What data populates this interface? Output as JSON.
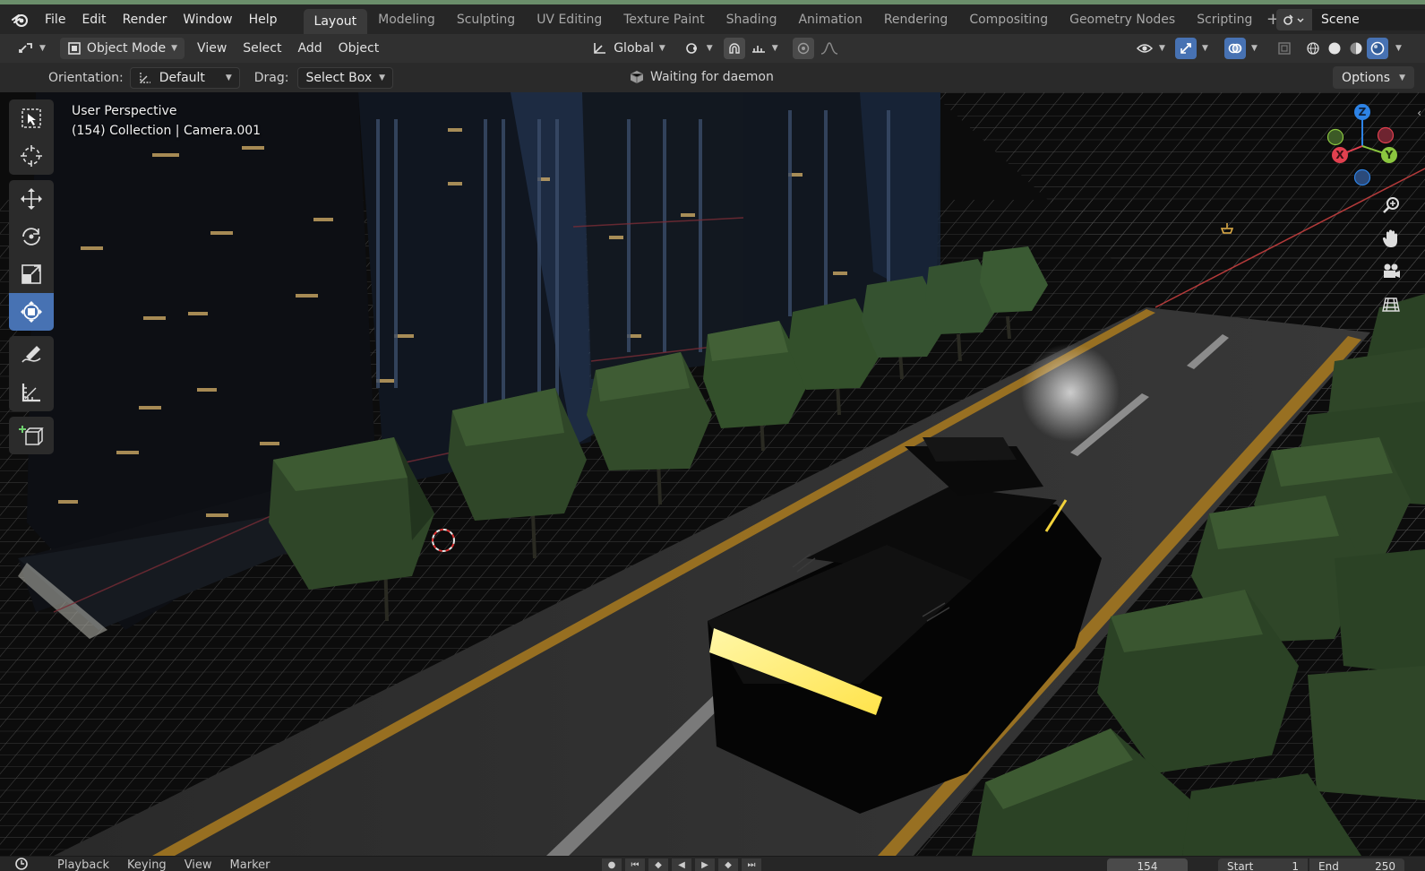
{
  "menu": {
    "items": [
      "File",
      "Edit",
      "Render",
      "Window",
      "Help"
    ]
  },
  "workspaces": {
    "tabs": [
      "Layout",
      "Modeling",
      "Sculpting",
      "UV Editing",
      "Texture Paint",
      "Shading",
      "Animation",
      "Rendering",
      "Compositing",
      "Geometry Nodes",
      "Scripting"
    ],
    "active": "Layout",
    "add_symbol": "+"
  },
  "scene": {
    "name": "Scene"
  },
  "header": {
    "mode": "Object Mode",
    "view": "View",
    "select": "Select",
    "add": "Add",
    "object": "Object",
    "transform_orientation": "Global"
  },
  "tool_settings": {
    "orientation_label": "Orientation:",
    "orientation_value": "Default",
    "drag_label": "Drag:",
    "drag_value": "Select Box",
    "status": "Waiting for daemon",
    "options": "Options"
  },
  "viewport": {
    "perspective": "User Perspective",
    "collection": "(154) Collection | Camera.001",
    "gizmo": {
      "x": "X",
      "y": "Y",
      "z": "Z"
    },
    "colors": {
      "x": "#e2404f",
      "y": "#8bc63f",
      "z": "#2d83e6",
      "accent": "#4772b3"
    }
  },
  "timeline": {
    "playback": "Playback",
    "keying": "Keying",
    "view": "View",
    "marker": "Marker",
    "current_frame": "154",
    "start_label": "Start",
    "start_value": "1",
    "end_label": "End",
    "end_value": "250"
  }
}
